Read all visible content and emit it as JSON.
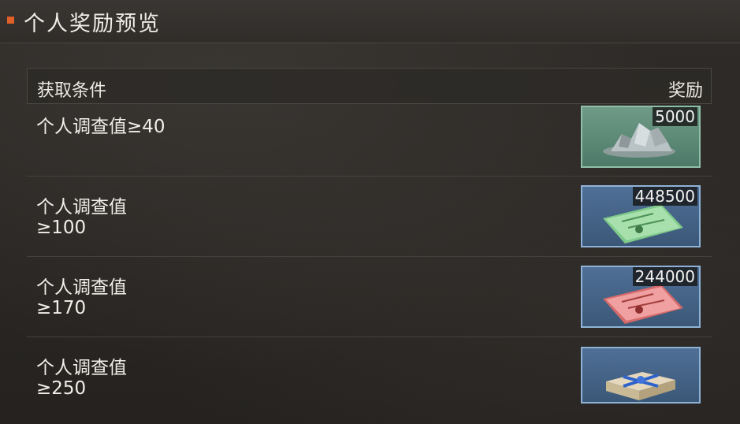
{
  "header": {
    "title": "个人奖励预览"
  },
  "table": {
    "condition_header": "获取条件",
    "reward_header": "奖励"
  },
  "rows": [
    {
      "condition": "个人调查值≥40",
      "reward_qty": "5000",
      "reward_icon": "silver-ore-icon",
      "frame_color": "#4d7a68"
    },
    {
      "condition": "个人调查值\n≥100",
      "reward_qty": "448500",
      "reward_icon": "green-ticket-icon",
      "frame_color": "#3b5878"
    },
    {
      "condition": "个人调查值\n≥170",
      "reward_qty": "244000",
      "reward_icon": "red-ticket-icon",
      "frame_color": "#3b5878"
    },
    {
      "condition": "个人调查值\n≥250",
      "reward_qty": "",
      "reward_icon": "gift-box-icon",
      "frame_color": "#3b5878"
    }
  ],
  "colors": {
    "accent": "#e0602a"
  }
}
